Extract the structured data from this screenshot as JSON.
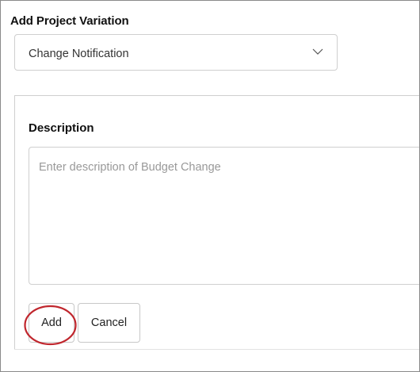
{
  "form": {
    "heading": "Add Project Variation",
    "variation_type": {
      "selected": "Change Notification",
      "icon": "chevron-down-icon"
    },
    "description": {
      "label": "Description",
      "value": "",
      "placeholder": "Enter description of Budget Change"
    },
    "buttons": {
      "add_label": "Add",
      "cancel_label": "Cancel"
    },
    "annotation": {
      "highlight_color": "#c0262d"
    }
  }
}
